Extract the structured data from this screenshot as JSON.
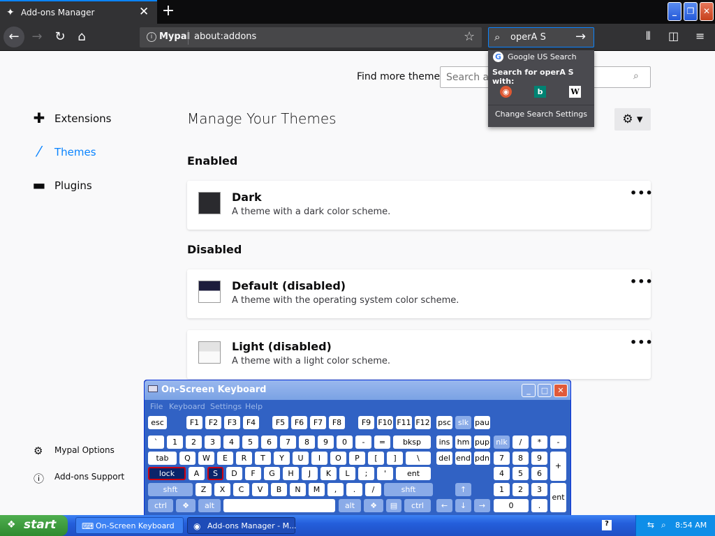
{
  "tab": {
    "title": "Add-ons Manager",
    "icon": "puzzle-icon"
  },
  "toolbar": {
    "identity": "Mypal",
    "url": "about:addons",
    "search_value": "operA S"
  },
  "search_popup": {
    "google": "Google US Search",
    "search_with": "Search for operA S with:",
    "change": "Change Search Settings"
  },
  "page": {
    "find_more": "Find more themes",
    "search_placeholder": "Search addons.mozilla.org",
    "title": "Manage Your Themes",
    "enabled_heading": "Enabled",
    "disabled_heading": "Disabled"
  },
  "categories": [
    {
      "label": "Extensions",
      "icon": "puzzle-icon"
    },
    {
      "label": "Themes",
      "icon": "brush-icon"
    },
    {
      "label": "Plugins",
      "icon": "plugin-icon"
    }
  ],
  "themes": [
    {
      "name": "Dark",
      "desc": "A theme with a dark color scheme."
    },
    {
      "name": "Default (disabled)",
      "desc": "A theme with the operating system color scheme."
    },
    {
      "name": "Light (disabled)",
      "desc": "A theme with a light color scheme."
    }
  ],
  "footer": {
    "options": "Mypal Options",
    "support": "Add-ons Support"
  },
  "osk": {
    "title": "On-Screen Keyboard",
    "menu": [
      "File",
      "Keyboard",
      "Settings",
      "Help"
    ],
    "keys": {
      "r1": [
        "esc",
        "F1",
        "F2",
        "F3",
        "F4",
        "F5",
        "F6",
        "F7",
        "F8",
        "F9",
        "F10",
        "F11",
        "F12",
        "psc",
        "slk",
        "pau"
      ],
      "r2": [
        "`",
        "1",
        "2",
        "3",
        "4",
        "5",
        "6",
        "7",
        "8",
        "9",
        "0",
        "-",
        "=",
        "bksp",
        "ins",
        "hm",
        "pup",
        "nlk",
        "/",
        "*",
        "-"
      ],
      "r3": [
        "tab",
        "Q",
        "W",
        "E",
        "R",
        "T",
        "Y",
        "U",
        "I",
        "O",
        "P",
        "[",
        "]",
        "\\",
        "del",
        "end",
        "pdn",
        "7",
        "8",
        "9",
        "+"
      ],
      "r4": [
        "lock",
        "A",
        "S",
        "D",
        "F",
        "G",
        "H",
        "J",
        "K",
        "L",
        ";",
        "'",
        "ent",
        "4",
        "5",
        "6"
      ],
      "r5": [
        "shft",
        "Z",
        "X",
        "C",
        "V",
        "B",
        "N",
        "M",
        ",",
        ".",
        "/",
        "shft",
        "↑",
        "1",
        "2",
        "3",
        "ent"
      ],
      "r6": [
        "ctrl",
        "alt",
        "alt",
        "ctrl",
        "←",
        "↓",
        "→",
        "0",
        "."
      ]
    }
  },
  "taskbar": {
    "start": "start",
    "tasks": [
      "On-Screen Keyboard",
      "Add-ons Manager - M..."
    ],
    "clock": "8:54 AM"
  }
}
